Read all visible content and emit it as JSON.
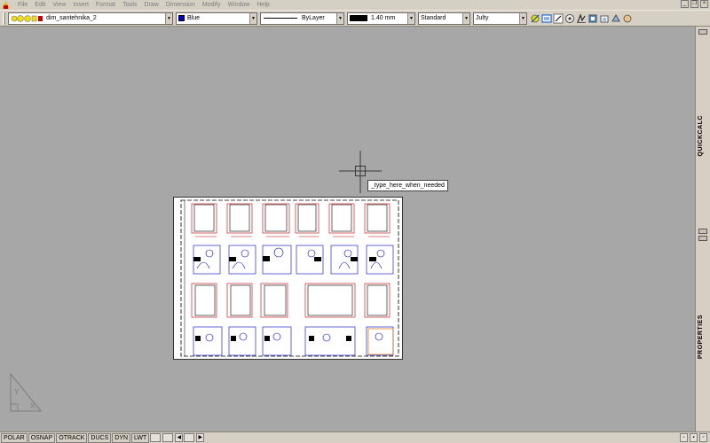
{
  "menu": {
    "items": [
      "File",
      "Edit",
      "View",
      "Insert",
      "Format",
      "Tools",
      "Draw",
      "Dimension",
      "Modify",
      "Window",
      "Help"
    ]
  },
  "toolbar": {
    "layer_name": "dim_santehnika_2",
    "color_name": "Blue",
    "color_swatch": "#0000c8",
    "linetype_name": "ByLayer",
    "lineweight_value": "1.40 mm",
    "text_style": "Standard",
    "dim_style": "Julty",
    "icons": [
      "layer-properties-icon",
      "layer-state-icon",
      "match-layer-icon",
      "color-icon",
      "linetype-icon",
      "lineweight-icon",
      "plot-icon",
      "publish-icon",
      "pan-icon"
    ]
  },
  "canvas": {
    "tooltip_text": "_type_here_when_needed",
    "background": "#a7a7a7"
  },
  "side_palette": {
    "top_title": "QUICKCALC",
    "bottom_title": "PROPERTIES"
  },
  "statusbar": {
    "toggles": [
      "POLAR",
      "OSNAP",
      "OTRACK",
      "DUCS",
      "DYN",
      "LWT"
    ]
  }
}
